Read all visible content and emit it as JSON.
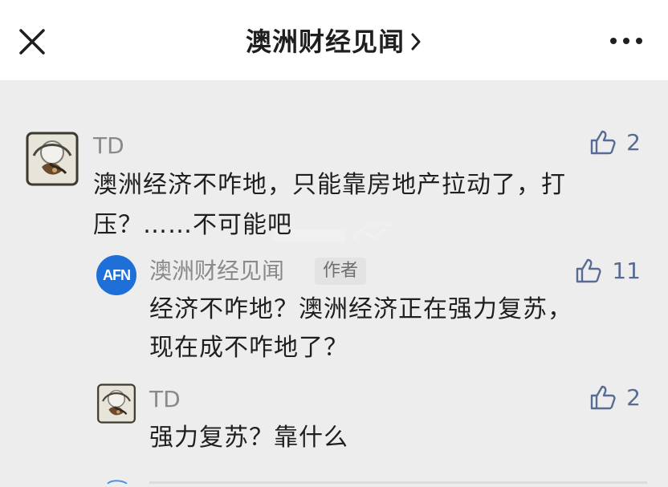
{
  "header": {
    "title": "澳洲财经见闻"
  },
  "comments": [
    {
      "author": "TD",
      "likes": "2",
      "lines": [
        "澳洲经济不咋地，只能靠房地产拉动了，打",
        "压？……不可能吧"
      ]
    },
    {
      "author": "澳洲财经见闻",
      "author_badge": "作者",
      "avatar_text": "AFN",
      "likes": "11",
      "lines": [
        "经济不咋地？澳洲经济正在强力复苏，",
        "现在成不咋地了？"
      ]
    },
    {
      "author": "TD",
      "likes": "2",
      "lines": [
        "强力复苏？靠什么"
      ]
    }
  ],
  "colors": {
    "background": "#ededed",
    "topbar": "#ffffff",
    "like_color": "#576b95",
    "name_color": "#8a8a8a",
    "afn_blue": "#1f6fd8"
  }
}
